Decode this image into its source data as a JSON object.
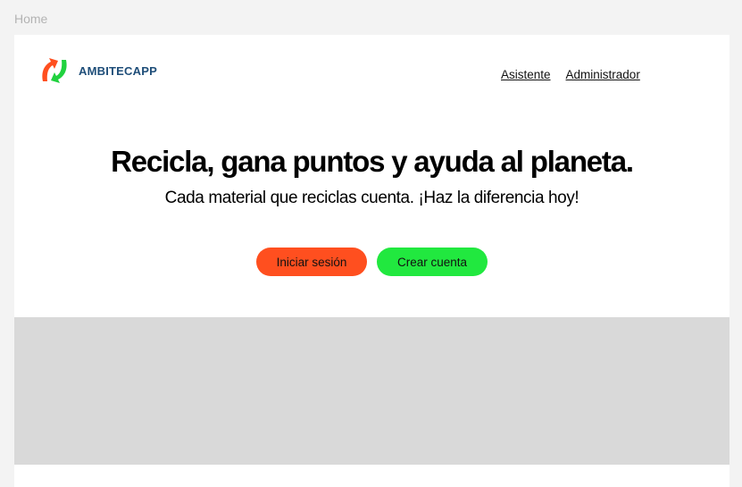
{
  "frame": {
    "label": "Home"
  },
  "header": {
    "brand": "AMBITECAPP",
    "nav": [
      {
        "label": "Asistente"
      },
      {
        "label": "Administrador"
      }
    ]
  },
  "hero": {
    "title": "Recicla, gana puntos y ayuda al planeta.",
    "subtitle": "Cada material que reciclas cuenta. ¡Haz la diferencia hoy!",
    "login_label": "Iniciar sesión",
    "signup_label": "Crear cuenta"
  },
  "colors": {
    "brand_text": "#1f4e79",
    "login_button": "#ff4f1f",
    "signup_button": "#21e83f",
    "banner": "#d9d9d9"
  },
  "icons": {
    "logo": "recycle-arrows-icon"
  }
}
